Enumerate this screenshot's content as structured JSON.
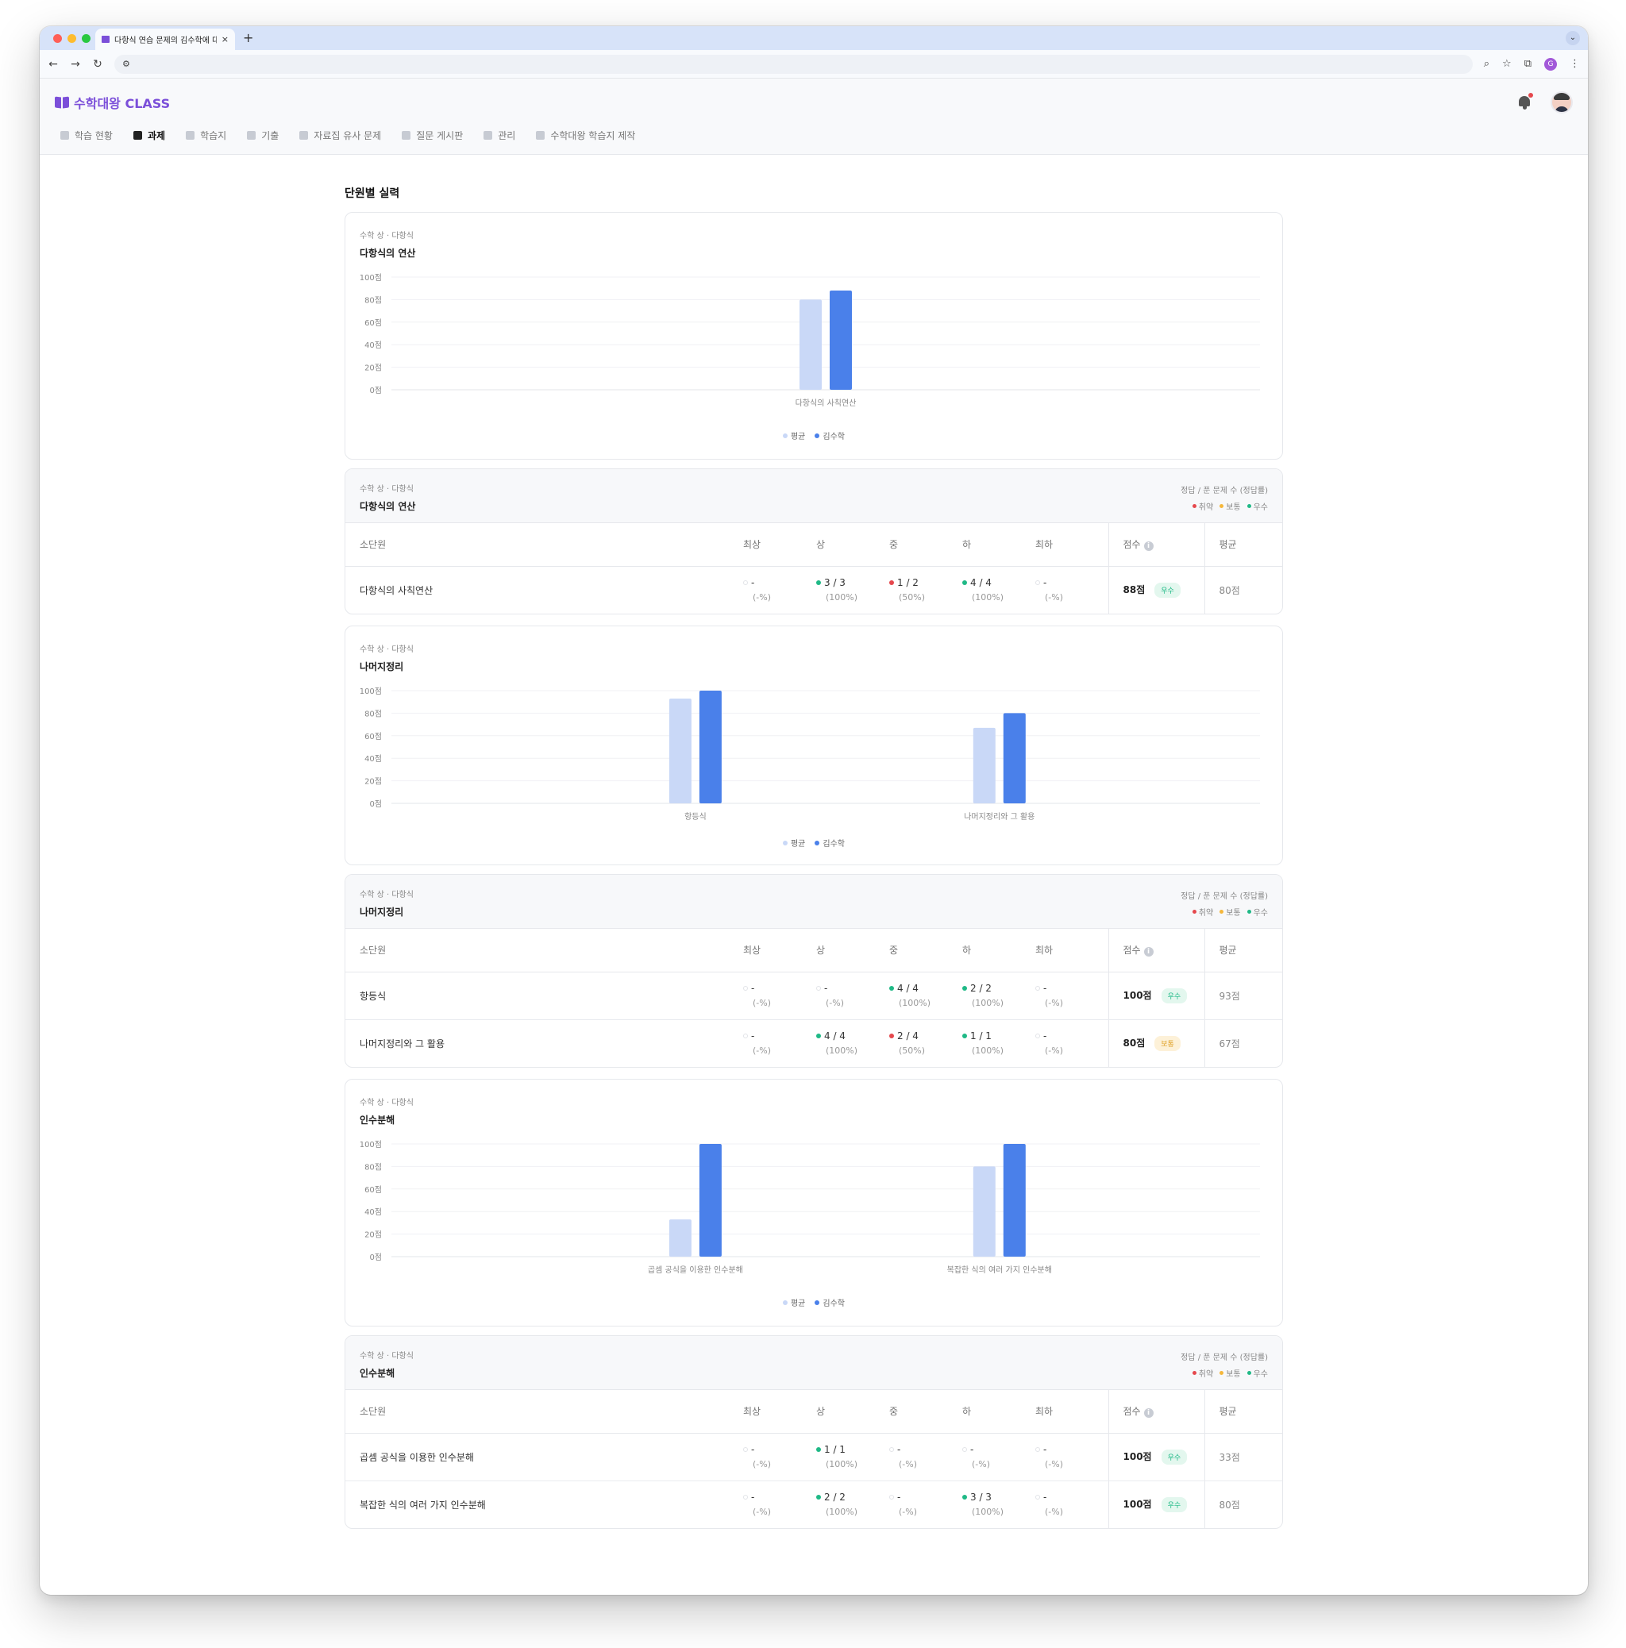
{
  "browser": {
    "tab_title": "다항식 연습 문제의 김수학에 대한 |",
    "tab_close": "×",
    "new_tab": "+",
    "colors": {
      "close": "#ff5f57",
      "minimize": "#febc2e",
      "maximize": "#28c840"
    },
    "profile_initial": "G"
  },
  "app": {
    "logo": "수학대왕 CLASS",
    "brand_color": "#7b4fd9",
    "menu": [
      {
        "label": "학습 현황",
        "icon": "graduation-cap-icon",
        "active": false
      },
      {
        "label": "과제",
        "icon": "document-icon",
        "active": true
      },
      {
        "label": "학습지",
        "icon": "worksheet-icon",
        "active": false
      },
      {
        "label": "기출",
        "icon": "layers-icon",
        "active": false
      },
      {
        "label": "자료집 유사 문제",
        "icon": "folder-icon",
        "active": false
      },
      {
        "label": "질문 게시판",
        "icon": "question-icon",
        "active": false
      },
      {
        "label": "관리",
        "icon": "gear-icon",
        "active": false
      },
      {
        "label": "수학대왕 학습지 제작",
        "icon": "book-icon",
        "active": false
      }
    ]
  },
  "page": {
    "section_title": "단원별 실력"
  },
  "legend_names": {
    "avg": "평균",
    "student": "김수학"
  },
  "colors": {
    "avg": "#c9d8f7",
    "student": "#4a80ea",
    "weak": "#e5484d",
    "normal": "#f5b73b",
    "good": "#1fb986"
  },
  "table_labels": {
    "note": "정답 / 푼 문제 수 (정답률)",
    "legend": [
      "취약",
      "보통",
      "우수"
    ],
    "headers": [
      "소단원",
      "최상",
      "상",
      "중",
      "하",
      "최하",
      "점수",
      "평균"
    ]
  },
  "units": [
    {
      "subject": "수학 상 · 다항식",
      "name": "다항식의 연산",
      "chart_data": {
        "type": "bar",
        "title": "다항식의 연산",
        "categories": [
          "다항식의 사칙연산"
        ],
        "series": [
          {
            "name": "평균",
            "values": [
              80
            ]
          },
          {
            "name": "김수학",
            "values": [
              88
            ]
          }
        ],
        "ylim": [
          0,
          100
        ],
        "yticks": [
          "100점",
          "80점",
          "60점",
          "40점",
          "20점",
          "0점"
        ],
        "grid": true,
        "legend": "bottom-center"
      },
      "rows": [
        {
          "name": "다항식의 사칙연산",
          "levels": [
            {
              "v": "-",
              "p": "(-%)",
              "s": "none"
            },
            {
              "v": "3 / 3",
              "p": "(100%)",
              "s": "good"
            },
            {
              "v": "1 / 2",
              "p": "(50%)",
              "s": "weak"
            },
            {
              "v": "4 / 4",
              "p": "(100%)",
              "s": "good"
            },
            {
              "v": "-",
              "p": "(-%)",
              "s": "none"
            }
          ],
          "score": "88점",
          "badge": "우수",
          "badge_type": "good",
          "avg": "80점"
        }
      ]
    },
    {
      "subject": "수학 상 · 다항식",
      "name": "나머지정리",
      "chart_data": {
        "type": "bar",
        "title": "나머지정리",
        "categories": [
          "항등식",
          "나머지정리와 그 활용"
        ],
        "series": [
          {
            "name": "평균",
            "values": [
              93,
              67
            ]
          },
          {
            "name": "김수학",
            "values": [
              100,
              80
            ]
          }
        ],
        "ylim": [
          0,
          100
        ],
        "yticks": [
          "100점",
          "80점",
          "60점",
          "40점",
          "20점",
          "0점"
        ],
        "grid": true,
        "legend": "bottom-center"
      },
      "rows": [
        {
          "name": "항등식",
          "levels": [
            {
              "v": "-",
              "p": "(-%)",
              "s": "none"
            },
            {
              "v": "-",
              "p": "(-%)",
              "s": "none"
            },
            {
              "v": "4 / 4",
              "p": "(100%)",
              "s": "good"
            },
            {
              "v": "2 / 2",
              "p": "(100%)",
              "s": "good"
            },
            {
              "v": "-",
              "p": "(-%)",
              "s": "none"
            }
          ],
          "score": "100점",
          "badge": "우수",
          "badge_type": "good",
          "avg": "93점"
        },
        {
          "name": "나머지정리와 그 활용",
          "levels": [
            {
              "v": "-",
              "p": "(-%)",
              "s": "none"
            },
            {
              "v": "4 / 4",
              "p": "(100%)",
              "s": "good"
            },
            {
              "v": "2 / 4",
              "p": "(50%)",
              "s": "weak"
            },
            {
              "v": "1 / 1",
              "p": "(100%)",
              "s": "good"
            },
            {
              "v": "-",
              "p": "(-%)",
              "s": "none"
            }
          ],
          "score": "80점",
          "badge": "보통",
          "badge_type": "normal",
          "avg": "67점"
        }
      ]
    },
    {
      "subject": "수학 상 · 다항식",
      "name": "인수분해",
      "chart_data": {
        "type": "bar",
        "title": "인수분해",
        "categories": [
          "곱셈 공식을 이용한 인수분해",
          "복잡한 식의 여러 가지 인수분해"
        ],
        "series": [
          {
            "name": "평균",
            "values": [
              33,
              80
            ]
          },
          {
            "name": "김수학",
            "values": [
              100,
              100
            ]
          }
        ],
        "ylim": [
          0,
          100
        ],
        "yticks": [
          "100점",
          "80점",
          "60점",
          "40점",
          "20점",
          "0점"
        ],
        "grid": true,
        "legend": "bottom-center"
      },
      "rows": [
        {
          "name": "곱셈 공식을 이용한 인수분해",
          "levels": [
            {
              "v": "-",
              "p": "(-%)",
              "s": "none"
            },
            {
              "v": "1 / 1",
              "p": "(100%)",
              "s": "good"
            },
            {
              "v": "-",
              "p": "(-%)",
              "s": "none"
            },
            {
              "v": "-",
              "p": "(-%)",
              "s": "none"
            },
            {
              "v": "-",
              "p": "(-%)",
              "s": "none"
            }
          ],
          "score": "100점",
          "badge": "우수",
          "badge_type": "good",
          "avg": "33점"
        },
        {
          "name": "복잡한 식의 여러 가지 인수분해",
          "levels": [
            {
              "v": "-",
              "p": "(-%)",
              "s": "none"
            },
            {
              "v": "2 / 2",
              "p": "(100%)",
              "s": "good"
            },
            {
              "v": "-",
              "p": "(-%)",
              "s": "none"
            },
            {
              "v": "3 / 3",
              "p": "(100%)",
              "s": "good"
            },
            {
              "v": "-",
              "p": "(-%)",
              "s": "none"
            }
          ],
          "score": "100점",
          "badge": "우수",
          "badge_type": "good",
          "avg": "80점"
        }
      ]
    }
  ]
}
